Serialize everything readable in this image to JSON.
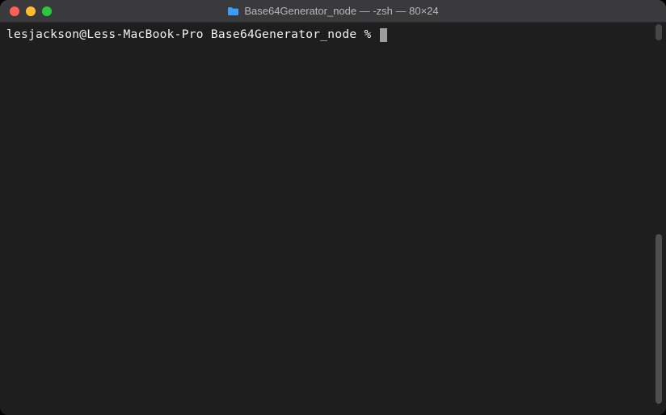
{
  "titlebar": {
    "title": "Base64Generator_node — -zsh — 80×24",
    "folder_icon": "folder-icon"
  },
  "terminal": {
    "prompt": "lesjackson@Less-MacBook-Pro Base64Generator_node % "
  },
  "colors": {
    "window_bg": "#1e1e1e",
    "titlebar_bg": "#3a3a3c",
    "text": "#f2f2f2",
    "close": "#ff5f57",
    "minimize": "#febc2e",
    "maximize": "#28c840",
    "folder": "#3b9eff"
  }
}
